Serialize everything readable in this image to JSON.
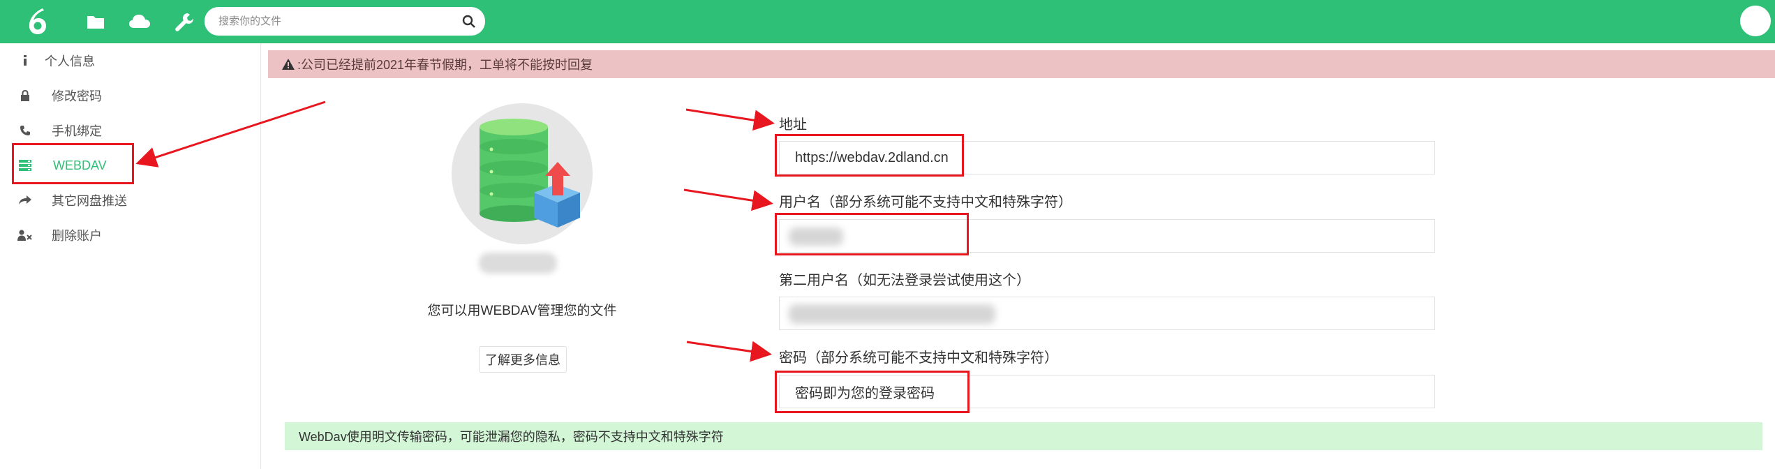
{
  "header": {
    "logo_icon": "logo-6-icon",
    "nav_icons": [
      "folder-icon",
      "cloud-icon",
      "wrench-icon"
    ],
    "search": {
      "placeholder": "搜索你的文件",
      "value": ""
    },
    "brand_color": "#2ec076"
  },
  "sidebar": {
    "items": [
      {
        "label": "个人信息",
        "icon": "info-icon"
      },
      {
        "label": "修改密码",
        "icon": "lock-icon"
      },
      {
        "label": "手机绑定",
        "icon": "phone-icon"
      },
      {
        "label": "WEBDAV",
        "icon": "server-icon",
        "active": true
      },
      {
        "label": "其它网盘推送",
        "icon": "share-icon"
      },
      {
        "label": "删除账户",
        "icon": "user-remove-icon"
      }
    ]
  },
  "notice": {
    "text": ":公司已经提前2021年春节假期，工单将不能按时回复",
    "icon": "warning-icon"
  },
  "panel": {
    "intro": "您可以用WEBDAV管理您的文件",
    "more_button": "了解更多信息"
  },
  "form": {
    "address": {
      "label": "地址",
      "value": "https://webdav.2dland.cn"
    },
    "username": {
      "label": "用户名（部分系统可能不支持中文和特殊字符）",
      "value": ""
    },
    "second_username": {
      "label": "第二用户名（如无法登录尝试使用这个）",
      "value": ""
    },
    "password": {
      "label": "密码（部分系统可能不支持中文和特殊字符）",
      "value": "密码即为您的登录密码"
    }
  },
  "info": {
    "text": "WebDav使用明文传输密码，可能泄漏您的隐私，密码不支持中文和特殊字符"
  },
  "colors": {
    "accent": "#2ec076",
    "notice_bg": "#ecc2c4",
    "info_bg": "#d2f6d6",
    "annotation": "#e8171f"
  }
}
